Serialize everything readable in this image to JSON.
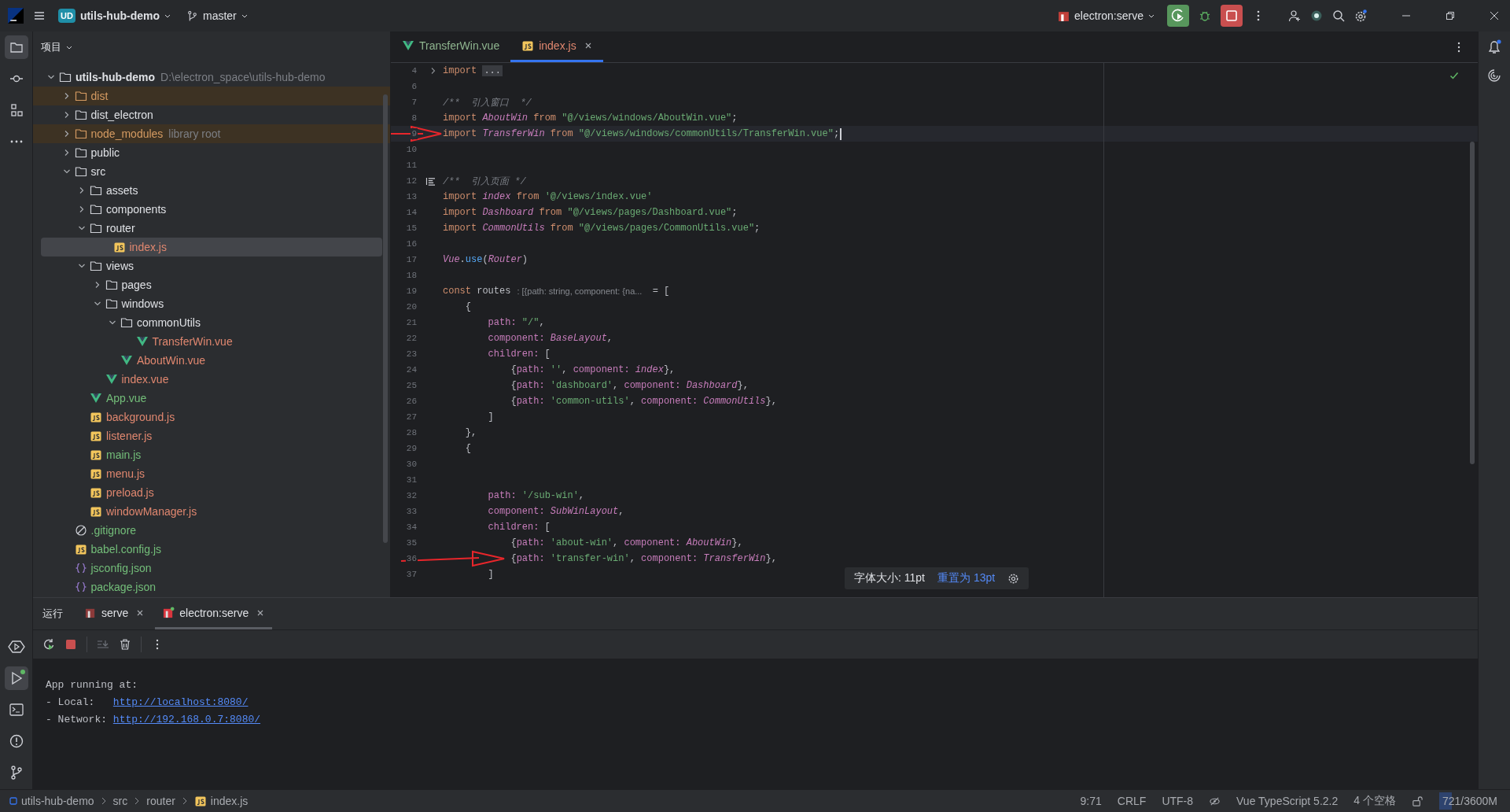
{
  "top_bar": {
    "project_badge": "UD",
    "project_name": "utils-hub-demo",
    "branch": "master",
    "run_config": "electron:serve"
  },
  "project_panel": {
    "title": "项目",
    "tree": [
      {
        "kind": "project",
        "name": "utils-hub-demo",
        "hint": "D:\\electron_space\\utils-hub-demo",
        "expanded": true,
        "selected": false,
        "color": "#dfe1e5",
        "children": [
          {
            "kind": "folder",
            "name": "dist",
            "expanded": false,
            "selected": false,
            "excluded": true,
            "color": "#d59b62"
          },
          {
            "kind": "folder",
            "name": "dist_electron",
            "expanded": false,
            "selected": false,
            "color": "#dfe1e5"
          },
          {
            "kind": "folder",
            "name": "node_modules",
            "hint": "library root",
            "expanded": false,
            "selected": false,
            "excluded": true,
            "color": "#d59b62"
          },
          {
            "kind": "folder",
            "name": "public",
            "expanded": false,
            "selected": false,
            "color": "#dfe1e5"
          },
          {
            "kind": "folder",
            "name": "src",
            "expanded": true,
            "selected": false,
            "color": "#dfe1e5",
            "children": [
              {
                "kind": "folder",
                "name": "assets",
                "expanded": false,
                "selected": false,
                "color": "#dfe1e5"
              },
              {
                "kind": "folder",
                "name": "components",
                "expanded": false,
                "selected": false,
                "color": "#dfe1e5"
              },
              {
                "kind": "folder",
                "name": "router",
                "expanded": true,
                "selected": false,
                "color": "#dfe1e5",
                "children": [
                  {
                    "kind": "js",
                    "name": "index.js",
                    "selected": true,
                    "color": "#e0876f"
                  }
                ]
              },
              {
                "kind": "folder",
                "name": "views",
                "expanded": true,
                "selected": false,
                "color": "#dfe1e5",
                "children": [
                  {
                    "kind": "folder",
                    "name": "pages",
                    "expanded": false,
                    "selected": false,
                    "color": "#dfe1e5"
                  },
                  {
                    "kind": "folder",
                    "name": "windows",
                    "expanded": true,
                    "selected": false,
                    "color": "#dfe1e5",
                    "children": [
                      {
                        "kind": "folder",
                        "name": "commonUtils",
                        "expanded": true,
                        "selected": false,
                        "color": "#dfe1e5",
                        "children": [
                          {
                            "kind": "vue",
                            "name": "TransferWin.vue",
                            "selected": false,
                            "color": "#e0876f"
                          }
                        ]
                      },
                      {
                        "kind": "vue",
                        "name": "AboutWin.vue",
                        "selected": false,
                        "color": "#e0876f"
                      }
                    ]
                  },
                  {
                    "kind": "vue",
                    "name": "index.vue",
                    "selected": false,
                    "color": "#e0876f"
                  }
                ]
              },
              {
                "kind": "vue",
                "name": "App.vue",
                "selected": false,
                "color": "#73bd79"
              },
              {
                "kind": "js",
                "name": "background.js",
                "selected": false,
                "color": "#e0876f"
              },
              {
                "kind": "js",
                "name": "listener.js",
                "selected": false,
                "color": "#e0876f"
              },
              {
                "kind": "js",
                "name": "main.js",
                "selected": false,
                "color": "#73bd79"
              },
              {
                "kind": "js",
                "name": "menu.js",
                "selected": false,
                "color": "#e0876f"
              },
              {
                "kind": "js",
                "name": "preload.js",
                "selected": false,
                "color": "#e0876f"
              },
              {
                "kind": "js",
                "name": "windowManager.js",
                "selected": false,
                "color": "#e0876f"
              }
            ]
          },
          {
            "kind": "ignore",
            "name": ".gitignore",
            "selected": false,
            "color": "#73bd79"
          },
          {
            "kind": "js",
            "name": "babel.config.js",
            "selected": false,
            "color": "#73bd79"
          },
          {
            "kind": "json",
            "name": "jsconfig.json",
            "selected": false,
            "color": "#73bd79"
          },
          {
            "kind": "json",
            "name": "package.json",
            "selected": false,
            "color": "#73bd79"
          }
        ]
      }
    ]
  },
  "editor": {
    "tabs": [
      {
        "label": "TransferWin.vue",
        "kind": "vue",
        "selected": false,
        "color": "#8fb58f"
      },
      {
        "label": "index.js",
        "kind": "js",
        "selected": true,
        "color": "#e0876f"
      }
    ],
    "lines": [
      {
        "number": "4",
        "current": false,
        "folded": true,
        "segments": [
          {
            "text": "import ",
            "kind": "kw"
          },
          {
            "text": "...",
            "kind": "fold"
          }
        ]
      },
      {
        "number": "6",
        "current": false
      },
      {
        "number": "7",
        "current": false,
        "segments": [
          {
            "text": "/**  引入窗口  */",
            "kind": "cmt"
          }
        ]
      },
      {
        "number": "8",
        "current": false,
        "segments": [
          {
            "text": "import ",
            "kind": "kw"
          },
          {
            "text": "AboutWin",
            "kind": "cls"
          },
          {
            "text": " from ",
            "kind": "kw"
          },
          {
            "text": "\"@/views/windows/AboutWin.vue\"",
            "kind": "str"
          },
          {
            "text": ";",
            "kind": "plain"
          }
        ]
      },
      {
        "number": "9",
        "current": true,
        "segments": [
          {
            "text": "import ",
            "kind": "kw"
          },
          {
            "text": "TransferWin",
            "kind": "cls"
          },
          {
            "text": " from ",
            "kind": "kw"
          },
          {
            "text": "\"@/views/windows/commonUtils/TransferWin.vue\"",
            "kind": "str"
          },
          {
            "text": ";",
            "kind": "plain"
          }
        ]
      },
      {
        "number": "10",
        "current": false
      },
      {
        "number": "11",
        "current": false
      },
      {
        "number": "12",
        "current": false,
        "doc_icon": true,
        "segments": [
          {
            "text": "/**  引入页面 */",
            "kind": "cmt"
          }
        ]
      },
      {
        "number": "13",
        "current": false,
        "segments": [
          {
            "text": "import ",
            "kind": "kw"
          },
          {
            "text": "index",
            "kind": "cls"
          },
          {
            "text": " from ",
            "kind": "kw"
          },
          {
            "text": "'@/views/index.vue'",
            "kind": "str"
          }
        ]
      },
      {
        "number": "14",
        "current": false,
        "segments": [
          {
            "text": "import ",
            "kind": "kw"
          },
          {
            "text": "Dashboard",
            "kind": "cls"
          },
          {
            "text": " from ",
            "kind": "kw"
          },
          {
            "text": "\"@/views/pages/Dashboard.vue\"",
            "kind": "str"
          },
          {
            "text": ";",
            "kind": "plain"
          }
        ]
      },
      {
        "number": "15",
        "current": false,
        "segments": [
          {
            "text": "import ",
            "kind": "kw"
          },
          {
            "text": "CommonUtils",
            "kind": "cls"
          },
          {
            "text": " from ",
            "kind": "kw"
          },
          {
            "text": "\"@/views/pages/CommonUtils.vue\"",
            "kind": "str"
          },
          {
            "text": ";",
            "kind": "plain"
          }
        ]
      },
      {
        "number": "16",
        "current": false
      },
      {
        "number": "17",
        "current": false,
        "segments": [
          {
            "text": "Vue",
            "kind": "cls"
          },
          {
            "text": ".",
            "kind": "plain"
          },
          {
            "text": "use",
            "kind": "fn"
          },
          {
            "text": "(",
            "kind": "plain"
          },
          {
            "text": "Router",
            "kind": "cls"
          },
          {
            "text": ")",
            "kind": "plain"
          }
        ]
      },
      {
        "number": "18",
        "current": false
      },
      {
        "number": "19",
        "current": false,
        "segments": [
          {
            "text": "const ",
            "kind": "kw"
          },
          {
            "text": "routes",
            "kind": "plain"
          },
          {
            "text": ": [{path: string, component: {na...",
            "kind": "hint"
          },
          {
            "text": " = [",
            "kind": "plain"
          }
        ]
      },
      {
        "number": "20",
        "current": false,
        "segments": [
          {
            "text": "    {",
            "kind": "plain"
          }
        ]
      },
      {
        "number": "21",
        "current": false,
        "segments": [
          {
            "text": "        path:",
            "kind": "prop"
          },
          {
            "text": " \"/\"",
            "kind": "str"
          },
          {
            "text": ",",
            "kind": "plain"
          }
        ]
      },
      {
        "number": "22",
        "current": false,
        "segments": [
          {
            "text": "        component:",
            "kind": "prop"
          },
          {
            "text": " BaseLayout",
            "kind": "cls"
          },
          {
            "text": ",",
            "kind": "plain"
          }
        ]
      },
      {
        "number": "23",
        "current": false,
        "segments": [
          {
            "text": "        children:",
            "kind": "prop"
          },
          {
            "text": " [",
            "kind": "plain"
          }
        ]
      },
      {
        "number": "24",
        "current": false,
        "segments": [
          {
            "text": "            {",
            "kind": "plain"
          },
          {
            "text": "path:",
            "kind": "prop"
          },
          {
            "text": " ''",
            "kind": "str"
          },
          {
            "text": ", ",
            "kind": "plain"
          },
          {
            "text": "component:",
            "kind": "prop"
          },
          {
            "text": " index",
            "kind": "cls"
          },
          {
            "text": "},",
            "kind": "plain"
          }
        ]
      },
      {
        "number": "25",
        "current": false,
        "segments": [
          {
            "text": "            {",
            "kind": "plain"
          },
          {
            "text": "path:",
            "kind": "prop"
          },
          {
            "text": " 'dashboard'",
            "kind": "str"
          },
          {
            "text": ", ",
            "kind": "plain"
          },
          {
            "text": "component:",
            "kind": "prop"
          },
          {
            "text": " Dashboard",
            "kind": "cls"
          },
          {
            "text": "},",
            "kind": "plain"
          }
        ]
      },
      {
        "number": "26",
        "current": false,
        "segments": [
          {
            "text": "            {",
            "kind": "plain"
          },
          {
            "text": "path:",
            "kind": "prop"
          },
          {
            "text": " 'common-utils'",
            "kind": "str"
          },
          {
            "text": ", ",
            "kind": "plain"
          },
          {
            "text": "component:",
            "kind": "prop"
          },
          {
            "text": " CommonUtils",
            "kind": "cls"
          },
          {
            "text": "},",
            "kind": "plain"
          }
        ]
      },
      {
        "number": "27",
        "current": false,
        "segments": [
          {
            "text": "        ]",
            "kind": "plain"
          }
        ]
      },
      {
        "number": "28",
        "current": false,
        "segments": [
          {
            "text": "    },",
            "kind": "plain"
          }
        ]
      },
      {
        "number": "29",
        "current": false,
        "segments": [
          {
            "text": "    {",
            "kind": "plain"
          }
        ]
      },
      {
        "number": "30",
        "current": false
      },
      {
        "number": "31",
        "current": false
      },
      {
        "number": "32",
        "current": false,
        "segments": [
          {
            "text": "        path:",
            "kind": "prop"
          },
          {
            "text": " '/sub-win'",
            "kind": "str"
          },
          {
            "text": ",",
            "kind": "plain"
          }
        ]
      },
      {
        "number": "33",
        "current": false,
        "segments": [
          {
            "text": "        component:",
            "kind": "prop"
          },
          {
            "text": " SubWinLayout",
            "kind": "cls"
          },
          {
            "text": ",",
            "kind": "plain"
          }
        ]
      },
      {
        "number": "34",
        "current": false,
        "segments": [
          {
            "text": "        children:",
            "kind": "prop"
          },
          {
            "text": " [",
            "kind": "plain"
          }
        ]
      },
      {
        "number": "35",
        "current": false,
        "segments": [
          {
            "text": "            {",
            "kind": "plain"
          },
          {
            "text": "path:",
            "kind": "prop"
          },
          {
            "text": " 'about-win'",
            "kind": "str"
          },
          {
            "text": ", ",
            "kind": "plain"
          },
          {
            "text": "component:",
            "kind": "prop"
          },
          {
            "text": " AboutWin",
            "kind": "cls"
          },
          {
            "text": "},",
            "kind": "plain"
          }
        ]
      },
      {
        "number": "36",
        "current": false,
        "segments": [
          {
            "text": "            {",
            "kind": "plain"
          },
          {
            "text": "path:",
            "kind": "prop"
          },
          {
            "text": " 'transfer-win'",
            "kind": "str"
          },
          {
            "text": ", ",
            "kind": "plain"
          },
          {
            "text": "component:",
            "kind": "prop"
          },
          {
            "text": " TransferWin",
            "kind": "cls"
          },
          {
            "text": "},",
            "kind": "plain"
          }
        ]
      },
      {
        "number": "37",
        "current": false,
        "segments": [
          {
            "text": "        ]",
            "kind": "plain"
          }
        ]
      }
    ],
    "font_popup": {
      "text": "字体大小: 11pt",
      "reset_link": "重置为 13pt"
    }
  },
  "run_panel": {
    "title": "运行",
    "tabs": [
      {
        "label": "serve",
        "selected": false,
        "running": false
      },
      {
        "label": "electron:serve",
        "selected": true,
        "running": true
      }
    ],
    "console": [
      {
        "text": "App running at:"
      },
      {
        "text": "- Local:   ",
        "link": "http://localhost:8080/"
      },
      {
        "text": "- Network: ",
        "link": "http://192.168.0.7:8080/"
      }
    ]
  },
  "status_bar": {
    "breadcrumb": [
      {
        "label": "utils-hub-demo",
        "kind": "module"
      },
      {
        "label": "src",
        "kind": "folder"
      },
      {
        "label": "router",
        "kind": "folder"
      },
      {
        "label": "index.js",
        "kind": "js"
      }
    ],
    "position": "9:71",
    "line_ending": "CRLF",
    "encoding": "UTF-8",
    "language": "Vue TypeScript 5.2.2",
    "indent": "4 个空格",
    "memory": {
      "text": "721/3600M",
      "level": 0.2
    }
  }
}
